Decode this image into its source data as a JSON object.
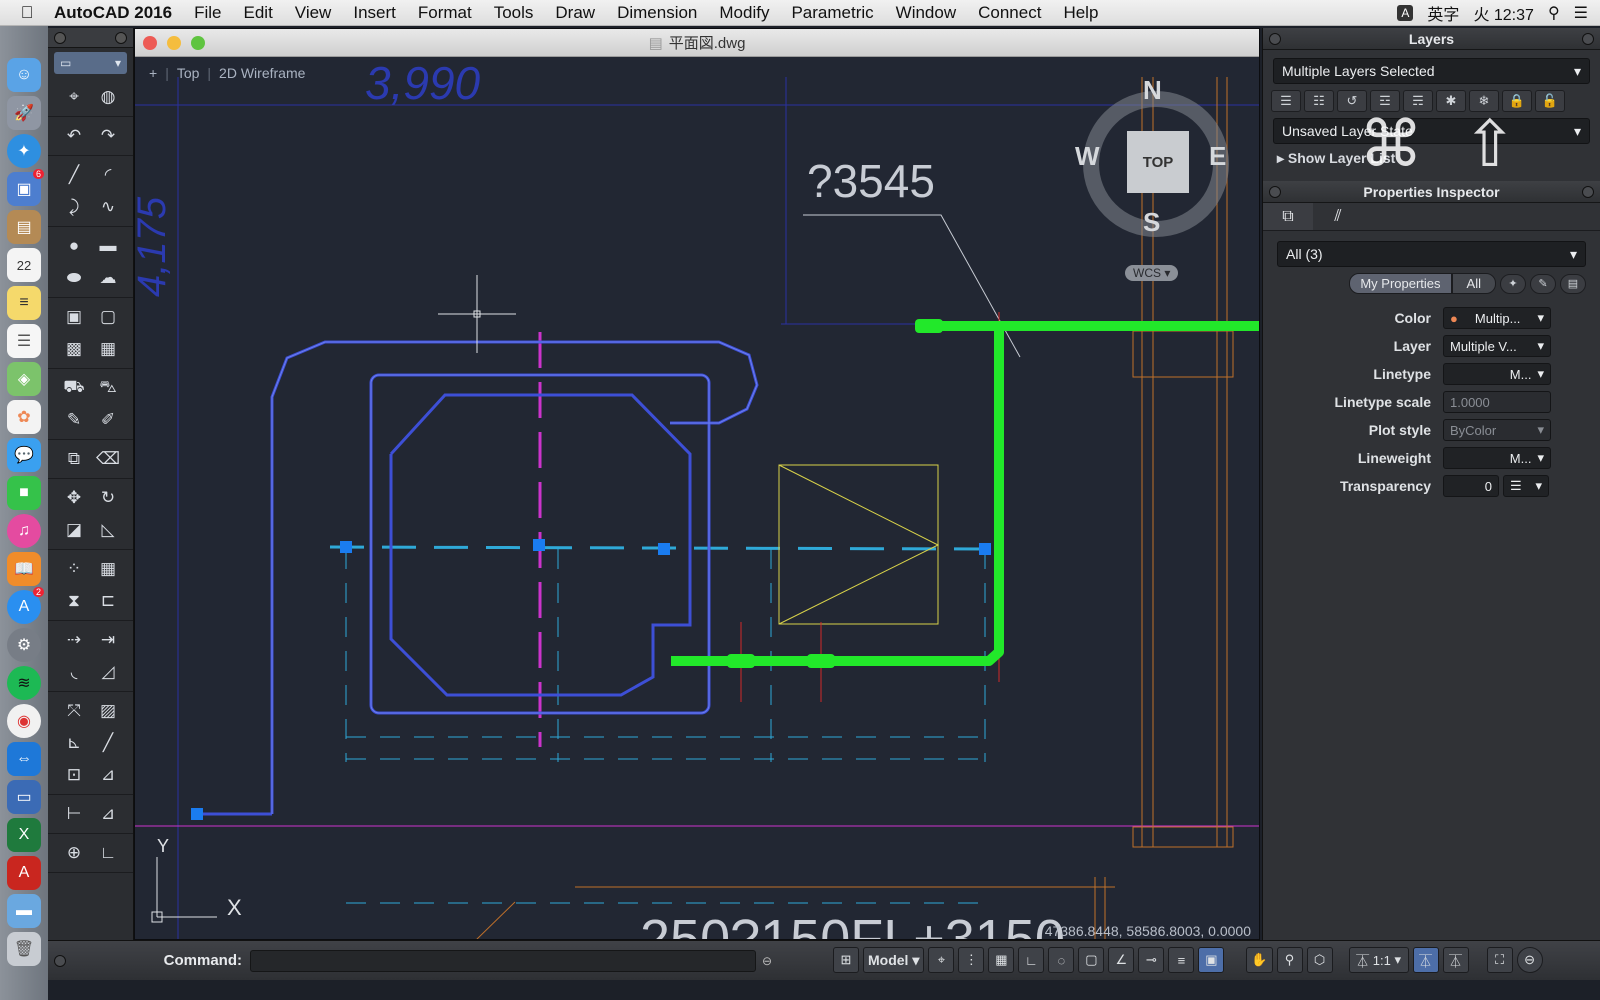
{
  "menubar": {
    "app_name": "AutoCAD 2016",
    "items": [
      "File",
      "Edit",
      "View",
      "Insert",
      "Format",
      "Tools",
      "Draw",
      "Dimension",
      "Modify",
      "Parametric",
      "Window",
      "Connect",
      "Help"
    ],
    "ime_badge": "A",
    "ime_label": "英字",
    "clock": "火 12:37"
  },
  "dock": {
    "icons": [
      "finder-icon",
      "launchpad-icon",
      "safari-icon",
      "photos-preview-icon",
      "contacts-icon",
      "calendar-icon",
      "notes-icon",
      "reminders-icon",
      "maps-icon",
      "photos-icon",
      "messages-icon",
      "facetime-icon",
      "itunes-icon",
      "ibooks-icon",
      "app-store-icon",
      "system-preferences-icon",
      "spotify-icon",
      "chrome-icon",
      "teamviewer-icon",
      "remote-desktop-icon",
      "excel-icon",
      "autocad-icon",
      "folder-icon",
      "trash-icon"
    ],
    "calendar_day": "22",
    "badges": {
      "photos-preview-icon": "6",
      "app-store-icon": "2"
    }
  },
  "drawing": {
    "file_title": "平面図.dwg",
    "viewport_plus": "+",
    "view_name": "Top",
    "visual_style": "2D Wireframe",
    "coordinates": "47386.8448, 58586.8003, 0.0000",
    "texts": {
      "dim_top": "3,990",
      "dim_left": "4,175",
      "label_3545": "?3545",
      "label_bottom": "250?150FL+3150"
    }
  },
  "viewcube": {
    "north": "N",
    "south": "S",
    "east": "E",
    "west": "W",
    "face": "TOP",
    "wcs": "WCS"
  },
  "ucs": {
    "x_label": "X",
    "y_label": "Y"
  },
  "layers_panel": {
    "title": "Layers",
    "layer_select": "Multiple Layers Selected",
    "layer_state": "Unsaved Layer State",
    "show_layer_list": "Show Layer List"
  },
  "properties_panel": {
    "title": "Properties Inspector",
    "filter": "All (3)",
    "seg_my_properties": "My Properties",
    "seg_all": "All",
    "rows": [
      {
        "label": "Color",
        "value": "Multip..."
      },
      {
        "label": "Layer",
        "value": "Multiple V..."
      },
      {
        "label": "Linetype",
        "value": "M..."
      },
      {
        "label": "Linetype scale",
        "value": "1.0000"
      },
      {
        "label": "Plot style",
        "value": "ByColor"
      },
      {
        "label": "Lineweight",
        "value": "M..."
      },
      {
        "label": "Transparency",
        "value": "0"
      }
    ]
  },
  "command_bar": {
    "label": "Command:",
    "model_button": "Model",
    "annotation_scale": "1:1"
  },
  "colors": {
    "canvas_bg": "#222733",
    "selected_polyline": "#3d4fd6",
    "green_pipe": "#22e82a",
    "cyan_dashed": "#2fa9d8",
    "yellow_symbol": "#d8d24a",
    "orange_lines": "#c0702a",
    "magenta_line": "#cc33cc"
  }
}
